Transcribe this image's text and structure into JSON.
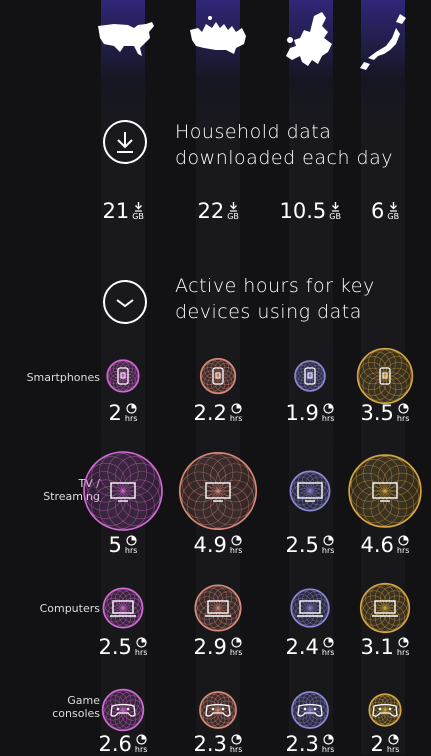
{
  "regions": [
    {
      "icon": "usa-map-icon"
    },
    {
      "icon": "canada-map-icon"
    },
    {
      "icon": "europe-map-icon"
    },
    {
      "icon": "japan-map-icon"
    }
  ],
  "colors": {
    "series": [
      "#d46ad6",
      "#d98a78",
      "#8c88d8",
      "#d7a742"
    ],
    "band_glow": "#4a3ad0"
  },
  "download": {
    "title_line1": "Household data",
    "title_line2": "downloaded each day",
    "icon": "download-arrow-icon",
    "unit": "GB",
    "values": [
      "21",
      "22",
      "10.5",
      "6"
    ]
  },
  "active": {
    "title_line1": "Active hours for key",
    "title_line2": "devices using data",
    "icon": "clock-icon",
    "unit": "hrs"
  },
  "chart_data": {
    "type": "bubble",
    "categories": [
      "Smartphones",
      "TV / Streaming",
      "Computers",
      "Game consoles"
    ],
    "category_lines": [
      [
        "Smartphones"
      ],
      [
        "TV /",
        "Streaming"
      ],
      [
        "Computers"
      ],
      [
        "Game",
        "consoles"
      ]
    ],
    "device_icons": [
      "smartphone-icon",
      "tv-icon",
      "laptop-icon",
      "gamepad-icon"
    ],
    "series": [
      {
        "values": [
          2,
          5,
          2.5,
          2.6
        ]
      },
      {
        "values": [
          2.2,
          4.9,
          2.9,
          2.3
        ]
      },
      {
        "values": [
          1.9,
          2.5,
          2.4,
          2.3
        ]
      },
      {
        "values": [
          3.5,
          4.6,
          3.1,
          2
        ]
      }
    ],
    "value_labels": [
      [
        "2",
        "5",
        "2.5",
        "2.6"
      ],
      [
        "2.2",
        "4.9",
        "2.9",
        "2.3"
      ],
      [
        "1.9",
        "2.5",
        "2.4",
        "2.3"
      ],
      [
        "3.5",
        "4.6",
        "3.1",
        "2"
      ]
    ]
  }
}
